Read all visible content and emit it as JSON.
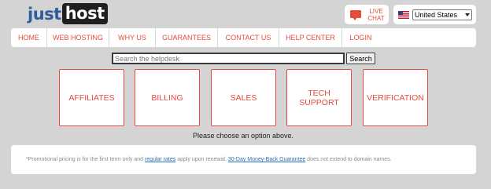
{
  "brand": {
    "logo_part1": "just",
    "logo_part2": "host"
  },
  "live_chat": {
    "label": "LIVE CHAT",
    "icon": "chat-bubble-icon",
    "color": "#e84a3c"
  },
  "country": {
    "flag_icon": "us-flag-icon",
    "selected": "United States"
  },
  "nav": {
    "items": [
      {
        "label": "HOME"
      },
      {
        "label": "WEB HOSTING"
      },
      {
        "label": "WHY US"
      },
      {
        "label": "GUARANTEES"
      },
      {
        "label": "CONTACT US"
      },
      {
        "label": "HELP CENTER"
      },
      {
        "label": "LOGIN"
      }
    ]
  },
  "search": {
    "placeholder": "Search the helpdesk",
    "value": "",
    "button_label": "Search"
  },
  "options": [
    {
      "label": "AFFILIATES"
    },
    {
      "label": "BILLING"
    },
    {
      "label": "SALES"
    },
    {
      "label": "TECH SUPPORT"
    },
    {
      "label": "VERIFICATION"
    }
  ],
  "prompt": "Please choose an option above.",
  "footer_note": {
    "text_before": "*Promotional pricing is for the first term only and ",
    "link1": "regular rates",
    "text_middle": " apply upon renewal. ",
    "link2": "30-Day Money-Back Guarantee",
    "text_after": " does not extend to domain names."
  },
  "colors": {
    "accent": "#e84a3c",
    "background": "#d4d4d4",
    "link": "#2a6fb8",
    "logo_blue": "#2f5b9f"
  }
}
